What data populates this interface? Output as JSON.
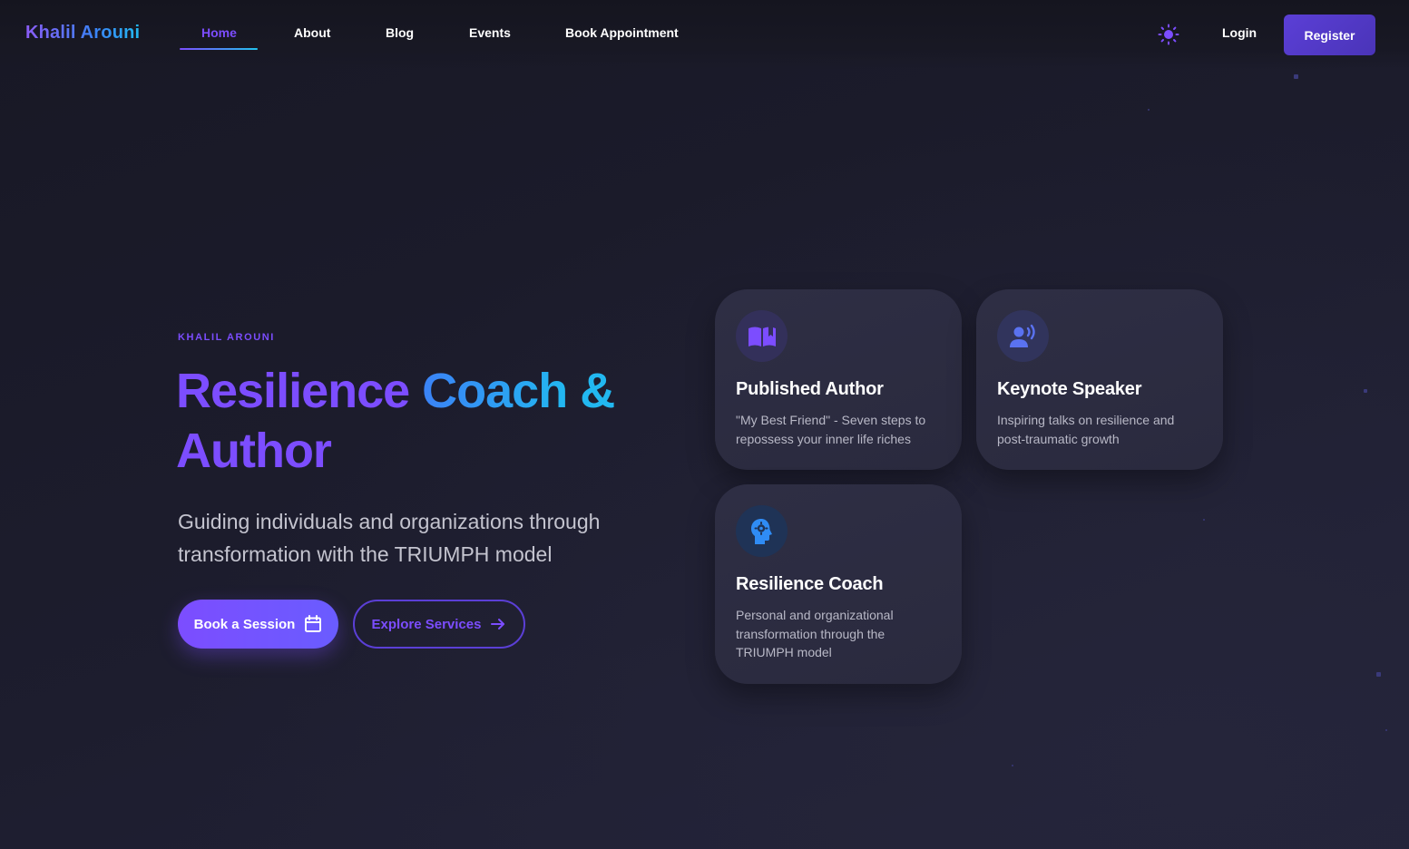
{
  "brand": {
    "name": "Khalil Arouni"
  },
  "nav": {
    "items": [
      {
        "label": "Home",
        "active": true
      },
      {
        "label": "About",
        "active": false
      },
      {
        "label": "Blog",
        "active": false
      },
      {
        "label": "Events",
        "active": false
      },
      {
        "label": "Book Appointment",
        "active": false
      }
    ],
    "theme_toggle_icon": "sun-icon",
    "login_label": "Login",
    "register_label": "Register"
  },
  "hero": {
    "eyebrow": "KHALIL AROUNI",
    "title_part1": "Resilience",
    "title_part2": "Coach",
    "title_part3": "&",
    "title_part4": "Author",
    "subtitle": "Guiding individuals and organizations through transformation with the TRIUMPH model",
    "primary_button": {
      "label": "Book a Session",
      "icon": "calendar-icon"
    },
    "secondary_button": {
      "label": "Explore Services",
      "icon": "arrow-right-icon"
    }
  },
  "cards": [
    {
      "icon": "book-icon",
      "title": "Published Author",
      "description": "\"My Best Friend\" - Seven steps to repossess your inner life riches"
    },
    {
      "icon": "speaker-icon",
      "title": "Keynote Speaker",
      "description": "Inspiring talks on resilience and post-traumatic growth"
    },
    {
      "icon": "head-gear-icon",
      "title": "Resilience Coach",
      "description": "Personal and organizational transformation through the TRIUMPH model"
    }
  ],
  "colors": {
    "background": "#1a1a28",
    "accent_purple": "#7c4dff",
    "accent_cyan": "#22b8f0",
    "card_bg": "#2e2e44"
  }
}
